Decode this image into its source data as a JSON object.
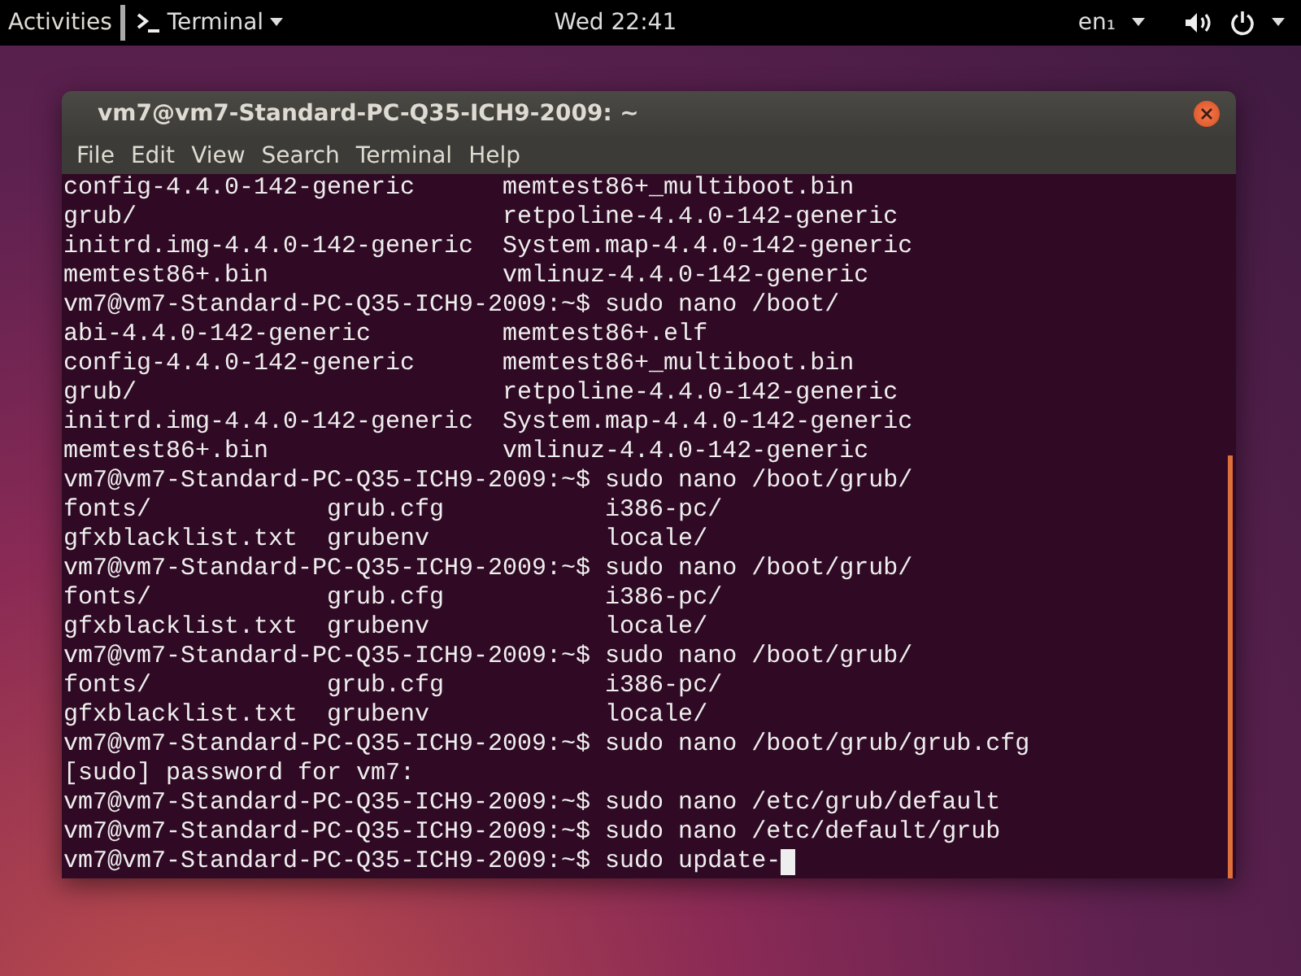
{
  "top_bar": {
    "activities": "Activities",
    "app_menu": "Terminal",
    "clock": "Wed 22:41",
    "keyboard_layout": "en₁"
  },
  "window": {
    "title": "vm7@vm7-Standard-PC-Q35-ICH9-2009: ~"
  },
  "menu": [
    "File",
    "Edit",
    "View",
    "Search",
    "Terminal",
    "Help"
  ],
  "terminal": {
    "cursor_visible": true,
    "lines": [
      "config-4.4.0-142-generic      memtest86+_multiboot.bin",
      "grub/                         retpoline-4.4.0-142-generic",
      "initrd.img-4.4.0-142-generic  System.map-4.4.0-142-generic",
      "memtest86+.bin                vmlinuz-4.4.0-142-generic",
      "vm7@vm7-Standard-PC-Q35-ICH9-2009:~$ sudo nano /boot/",
      "abi-4.4.0-142-generic         memtest86+.elf",
      "config-4.4.0-142-generic      memtest86+_multiboot.bin",
      "grub/                         retpoline-4.4.0-142-generic",
      "initrd.img-4.4.0-142-generic  System.map-4.4.0-142-generic",
      "memtest86+.bin                vmlinuz-4.4.0-142-generic",
      "vm7@vm7-Standard-PC-Q35-ICH9-2009:~$ sudo nano /boot/grub/",
      "fonts/            grub.cfg           i386-pc/",
      "gfxblacklist.txt  grubenv            locale/",
      "vm7@vm7-Standard-PC-Q35-ICH9-2009:~$ sudo nano /boot/grub/",
      "fonts/            grub.cfg           i386-pc/",
      "gfxblacklist.txt  grubenv            locale/",
      "vm7@vm7-Standard-PC-Q35-ICH9-2009:~$ sudo nano /boot/grub/",
      "fonts/            grub.cfg           i386-pc/",
      "gfxblacklist.txt  grubenv            locale/",
      "vm7@vm7-Standard-PC-Q35-ICH9-2009:~$ sudo nano /boot/grub/grub.cfg",
      "[sudo] password for vm7:",
      "vm7@vm7-Standard-PC-Q35-ICH9-2009:~$ sudo nano /etc/grub/default",
      "vm7@vm7-Standard-PC-Q35-ICH9-2009:~$ sudo nano /etc/default/grub",
      "vm7@vm7-Standard-PC-Q35-ICH9-2009:~$ sudo update-"
    ]
  }
}
